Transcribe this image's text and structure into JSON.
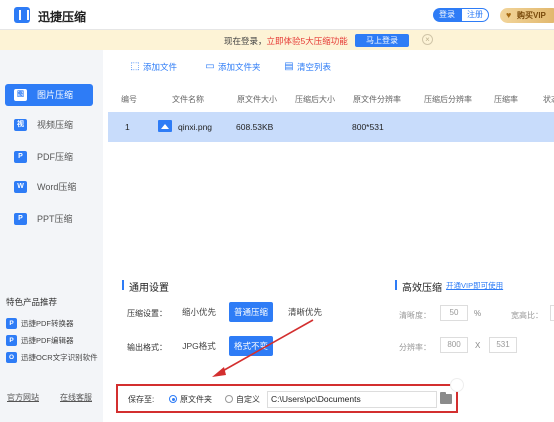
{
  "titlebar": {
    "app_title": "迅捷压缩",
    "login_label": "登录",
    "register_label": "注册",
    "vip_label": "购买VIP"
  },
  "notice": {
    "text_prefix": "现在登录，",
    "text_highlight": "立即体验5大压缩功能",
    "login_now_label": "马上登录",
    "close_symbol": "×"
  },
  "sidebar": {
    "items": [
      {
        "label": "图片压缩",
        "icon": "image-icon",
        "glyph": "图",
        "active": true
      },
      {
        "label": "视频压缩",
        "icon": "video-icon",
        "glyph": "视",
        "active": false
      },
      {
        "label": "PDF压缩",
        "icon": "pdf-icon",
        "glyph": "P",
        "active": false
      },
      {
        "label": "Word压缩",
        "icon": "word-icon",
        "glyph": "W",
        "active": false
      },
      {
        "label": "PPT压缩",
        "icon": "ppt-icon",
        "glyph": "P",
        "active": false
      }
    ],
    "featured_title": "特色产品推荐",
    "featured": [
      {
        "label": "迅捷PDF转换器",
        "glyph": "P",
        "color": "#2e7cf6"
      },
      {
        "label": "迅捷PDF编辑器",
        "glyph": "P",
        "color": "#2e7cf6"
      },
      {
        "label": "迅捷OCR文字识别软件",
        "glyph": "O",
        "color": "#2e7cf6"
      }
    ],
    "official_site": "官方网站",
    "online_support": "在线客服"
  },
  "toolbar": {
    "add_file": "添加文件",
    "add_folder": "添加文件夹",
    "clear_list": "清空列表"
  },
  "table": {
    "headers": [
      "编号",
      "文件名称",
      "原文件大小",
      "压缩后大小",
      "原文件分辨率",
      "压缩后分辨率",
      "压缩率",
      "状态"
    ],
    "rows": [
      {
        "index": "1",
        "name": "qinxi.png",
        "orig_size": "608.53KB",
        "compressed_size": "",
        "orig_resolution": "800*531",
        "compressed_resolution": "",
        "ratio": "",
        "status": ""
      }
    ]
  },
  "settings": {
    "general_title": "通用设置",
    "compress_setting_label": "压缩设置：",
    "compress_options": [
      {
        "label": "缩小优先",
        "selected": false
      },
      {
        "label": "普通压缩",
        "selected": true
      },
      {
        "label": "清晰优先",
        "selected": false
      }
    ],
    "output_format_label": "输出格式：",
    "format_options": [
      {
        "label": "JPG格式",
        "selected": false
      },
      {
        "label": "格式不变",
        "selected": true
      }
    ],
    "efficient_title": "高效压缩",
    "vip_link": "开通VIP即可使用",
    "clarity_label": "清晰度：",
    "clarity_value": "50",
    "clarity_unit": "%",
    "ratio_label": "宽高比：",
    "resolution_label": "分辨率：",
    "res_width": "800",
    "res_sep": "X",
    "res_height": "531"
  },
  "save": {
    "label": "保存至:",
    "option_original": "原文件夹",
    "option_custom": "自定义",
    "path": "C:\\Users\\pc\\Documents",
    "selected": "original"
  },
  "colors": {
    "accent": "#2e7cf6",
    "annotation_red": "#d32f2f",
    "notice_bg": "#fdf3d6",
    "row_selected": "#c8dcfb"
  }
}
